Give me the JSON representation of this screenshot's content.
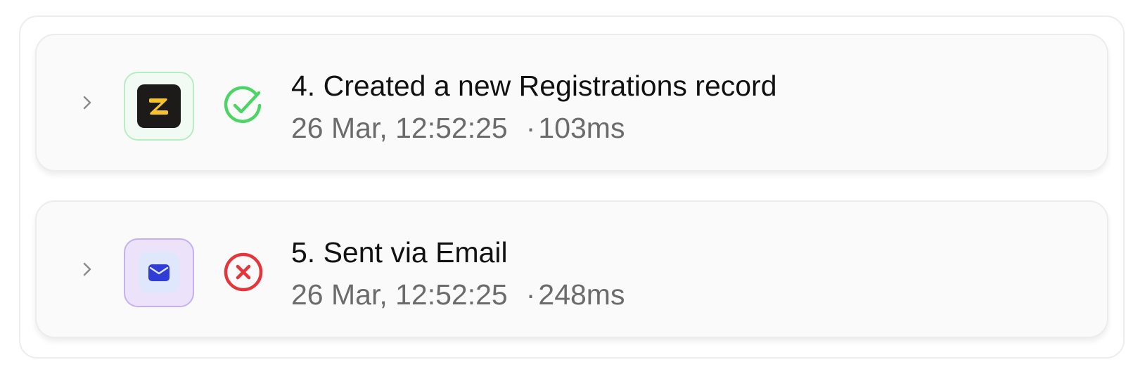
{
  "steps": [
    {
      "title": "4. Created a new Registrations record",
      "timestamp": "26 Mar, 12:52:25",
      "separator": "·",
      "duration": "103ms",
      "app_icon": "zoho-icon",
      "status": "success",
      "status_icon": "check-circle-icon",
      "status_color": "#4cd465",
      "expand_icon": "chevron-right-icon"
    },
    {
      "title": "5. Sent via Email",
      "timestamp": "26 Mar, 12:52:25",
      "separator": "·",
      "duration": "248ms",
      "app_icon": "email-icon",
      "status": "error",
      "status_icon": "x-circle-icon",
      "status_color": "#e5353b",
      "expand_icon": "chevron-right-icon"
    }
  ],
  "colors": {
    "zoho_tile": "#1d1b19",
    "zoho_accent": "#f5c42c",
    "email_accent": "#2f3dd6",
    "email_badge_border": "#c4b0f3",
    "zoho_badge_border": "#b8edc4"
  }
}
